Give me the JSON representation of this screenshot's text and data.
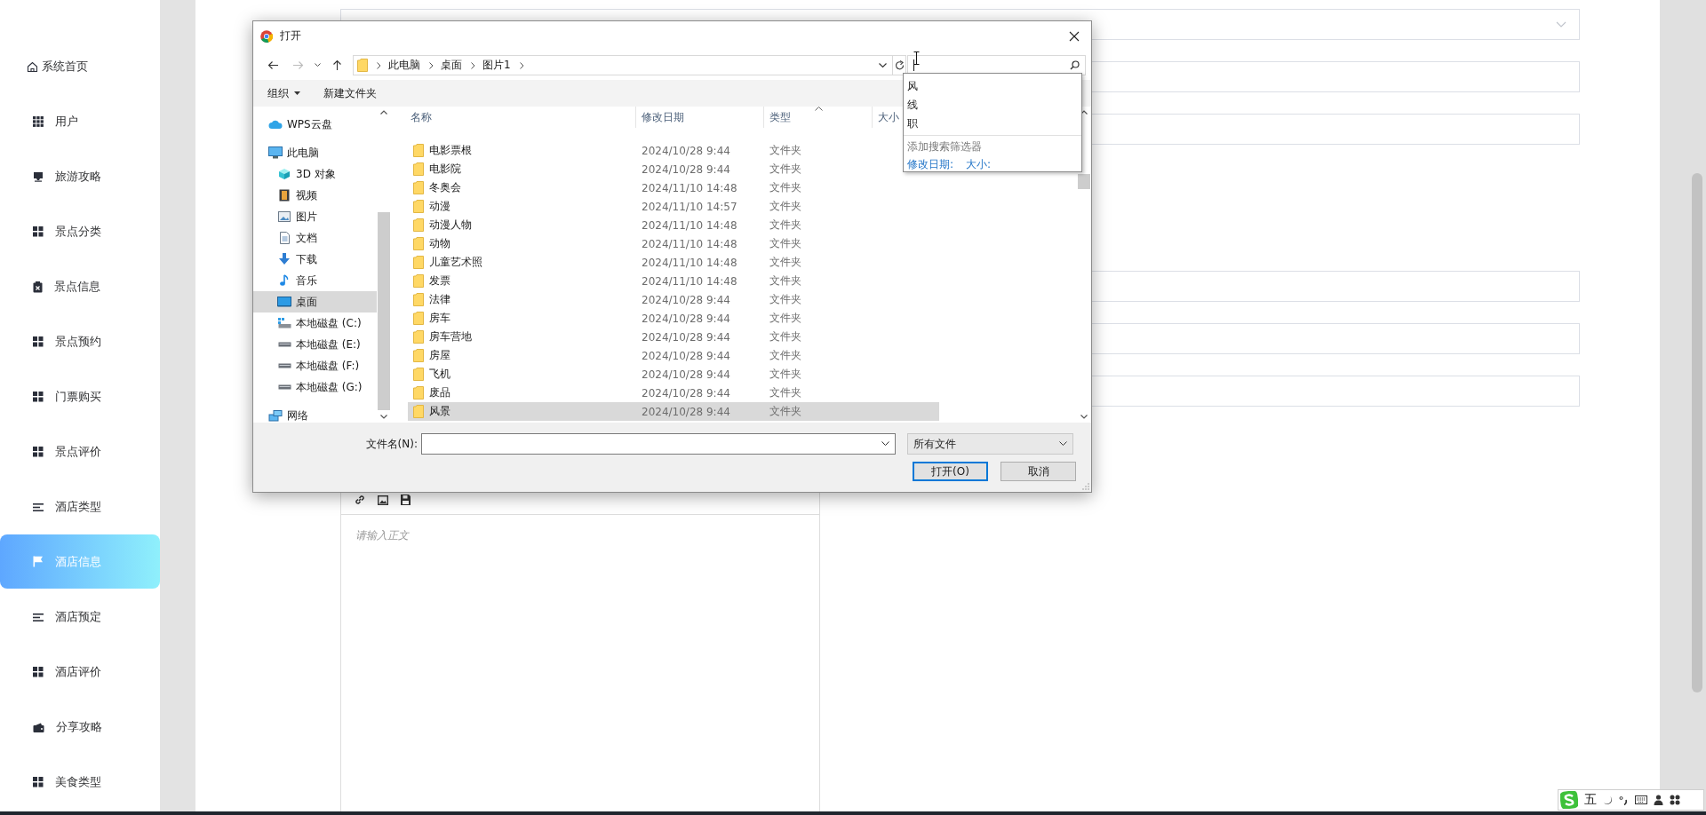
{
  "sidebar": {
    "items": [
      {
        "label": "系统首页",
        "kind": "home",
        "selected": false
      },
      {
        "label": "用户",
        "kind": "grid9",
        "selected": false
      },
      {
        "label": "旅游攻略",
        "kind": "tray",
        "selected": false
      },
      {
        "label": "景点分类",
        "kind": "grid4",
        "selected": false
      },
      {
        "label": "景点信息",
        "kind": "clipboard",
        "selected": false
      },
      {
        "label": "景点预约",
        "kind": "grid4",
        "selected": false
      },
      {
        "label": "门票购买",
        "kind": "grid4",
        "selected": false
      },
      {
        "label": "景点评价",
        "kind": "grid4",
        "selected": false
      },
      {
        "label": "酒店类型",
        "kind": "list",
        "selected": false
      },
      {
        "label": "酒店信息",
        "kind": "flag",
        "selected": true
      },
      {
        "label": "酒店预定",
        "kind": "list",
        "selected": false
      },
      {
        "label": "酒店评价",
        "kind": "grid4",
        "selected": false
      },
      {
        "label": "分享攻略",
        "kind": "wallet",
        "selected": false
      },
      {
        "label": "美食类型",
        "kind": "grid4",
        "selected": false
      }
    ]
  },
  "form": {
    "fields": [
      {
        "kind": "select"
      },
      {
        "kind": "text"
      },
      {
        "kind": "text"
      },
      {
        "kind": "text"
      },
      {
        "kind": "text"
      },
      {
        "kind": "text"
      }
    ]
  },
  "editor": {
    "placeholder": "请输入正文"
  },
  "dialog": {
    "title": "打开",
    "path": [
      "此电脑",
      "桌面",
      "图片1"
    ],
    "search": {
      "suggestions": [
        "风",
        "线",
        "职"
      ],
      "filter_heading": "添加搜索筛选器",
      "filters": [
        "修改日期:",
        "大小:"
      ]
    },
    "toolbar": [
      {
        "label": "组织",
        "menu": true
      },
      {
        "label": "新建文件夹",
        "menu": false
      }
    ],
    "nav": [
      {
        "label": "WPS云盘",
        "kind": "cloud",
        "selected": false
      },
      {
        "label": "此电脑",
        "kind": "pc",
        "selected": false,
        "children": [
          {
            "label": "3D 对象",
            "kind": "cube",
            "selected": false
          },
          {
            "label": "视频",
            "kind": "film",
            "selected": false
          },
          {
            "label": "图片",
            "kind": "picture",
            "selected": false
          },
          {
            "label": "文档",
            "kind": "doc",
            "selected": false
          },
          {
            "label": "下载",
            "kind": "download",
            "selected": false
          },
          {
            "label": "音乐",
            "kind": "music",
            "selected": false
          },
          {
            "label": "桌面",
            "kind": "desktop",
            "selected": true
          },
          {
            "label": "本地磁盘 (C:)",
            "kind": "system-drive",
            "selected": false
          },
          {
            "label": "本地磁盘 (E:)",
            "kind": "drive",
            "selected": false
          },
          {
            "label": "本地磁盘 (F:)",
            "kind": "drive",
            "selected": false
          },
          {
            "label": "本地磁盘 (G:)",
            "kind": "drive",
            "selected": false
          }
        ]
      },
      {
        "label": "网络",
        "kind": "network",
        "selected": false
      }
    ],
    "columns": [
      {
        "label": "名称",
        "sorted": false
      },
      {
        "label": "修改日期",
        "sorted": false
      },
      {
        "label": "类型",
        "sorted": true
      },
      {
        "label": "大小",
        "sorted": false
      }
    ],
    "rows": [
      {
        "name": "电影票根",
        "modified": "2024/10/28 9:44",
        "type": "文件夹",
        "selected": false
      },
      {
        "name": "电影院",
        "modified": "2024/10/28 9:44",
        "type": "文件夹",
        "selected": false
      },
      {
        "name": "冬奥会",
        "modified": "2024/11/10 14:48",
        "type": "文件夹",
        "selected": false
      },
      {
        "name": "动漫",
        "modified": "2024/11/10 14:57",
        "type": "文件夹",
        "selected": false
      },
      {
        "name": "动漫人物",
        "modified": "2024/11/10 14:48",
        "type": "文件夹",
        "selected": false
      },
      {
        "name": "动物",
        "modified": "2024/11/10 14:48",
        "type": "文件夹",
        "selected": false
      },
      {
        "name": "儿童艺术照",
        "modified": "2024/11/10 14:48",
        "type": "文件夹",
        "selected": false
      },
      {
        "name": "发票",
        "modified": "2024/11/10 14:48",
        "type": "文件夹",
        "selected": false
      },
      {
        "name": "法律",
        "modified": "2024/10/28 9:44",
        "type": "文件夹",
        "selected": false
      },
      {
        "name": "房车",
        "modified": "2024/10/28 9:44",
        "type": "文件夹",
        "selected": false
      },
      {
        "name": "房车营地",
        "modified": "2024/10/28 9:44",
        "type": "文件夹",
        "selected": false
      },
      {
        "name": "房屋",
        "modified": "2024/10/28 9:44",
        "type": "文件夹",
        "selected": false
      },
      {
        "name": "飞机",
        "modified": "2024/10/28 9:44",
        "type": "文件夹",
        "selected": false
      },
      {
        "name": "废品",
        "modified": "2024/10/28 9:44",
        "type": "文件夹",
        "selected": false
      },
      {
        "name": "风景",
        "modified": "2024/10/28 9:44",
        "type": "文件夹",
        "selected": true
      }
    ],
    "filename_label": "文件名(N):",
    "filter": "所有文件",
    "buttons": [
      {
        "label": "打开(O)",
        "default": true
      },
      {
        "label": "取消",
        "default": false
      }
    ]
  },
  "ime": {
    "mode": "五"
  }
}
